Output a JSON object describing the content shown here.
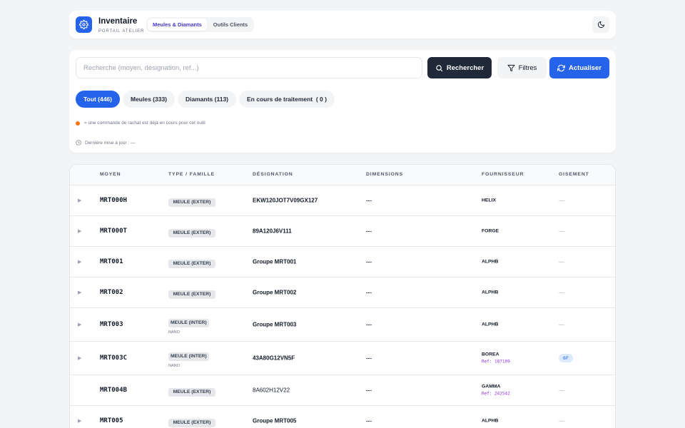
{
  "header": {
    "title": "Inventaire",
    "subtitle": "PORTAIL ATELIER",
    "tabs": [
      {
        "label": "Meules & Diamants",
        "active": true
      },
      {
        "label": "Outils Clients",
        "active": false
      }
    ],
    "icons": {
      "logo": "gear-icon",
      "theme": "moon-icon"
    }
  },
  "controls": {
    "search_placeholder": "Recherche (moyen, désignation, ref...)",
    "search_value": "",
    "search_button": "Rechercher",
    "filter_button": "Filtres",
    "refresh_button": "Actualiser",
    "chips": [
      {
        "label": "Tout (446)",
        "active": true
      },
      {
        "label": "Meules (333)",
        "active": false
      },
      {
        "label": "Diamants (113)",
        "active": false
      },
      {
        "label": "En cours de traitement  ( 0 )",
        "active": false
      }
    ],
    "legend_text": "= une commande de rachat est déjà en cours pour cet outil",
    "last_update": "Dernière mise à jour : —"
  },
  "table": {
    "columns": [
      "MOYEN",
      "TYPE / FAMILLE",
      "DÉSIGNATION",
      "DIMENSIONS",
      "FOURNISSEUR",
      "GISEMENT"
    ],
    "rows": [
      {
        "caret": "▶",
        "moyen": "MRT000H",
        "type": "MEULE (EXTER)",
        "type_style": "block",
        "family": "",
        "designation": "EKW120JOT7V09GX127",
        "designation_bold": true,
        "dimensions": "---",
        "fournisseur": "HELIX",
        "ref": "",
        "gisement": "---",
        "gisement_badge": false
      },
      {
        "caret": "▶",
        "moyen": "MRT000T",
        "type": "MEULE (EXTER)",
        "type_style": "block",
        "family": "",
        "designation": "89A120J6V111",
        "designation_bold": true,
        "dimensions": "---",
        "fournisseur": "FORGE",
        "ref": "",
        "gisement": "---",
        "gisement_badge": false
      },
      {
        "caret": "▶",
        "moyen": "MRT001",
        "type": "MEULE (EXTER)",
        "type_style": "block",
        "family": "",
        "designation": "Groupe MRT001",
        "designation_bold": true,
        "dimensions": "---",
        "fournisseur": "ALPHB",
        "ref": "",
        "gisement": "---",
        "gisement_badge": false
      },
      {
        "caret": "▶",
        "moyen": "MRT002",
        "type": "MEULE (EXTER)",
        "type_style": "block",
        "family": "",
        "designation": "Groupe MRT002",
        "designation_bold": true,
        "dimensions": "---",
        "fournisseur": "ALPHB",
        "ref": "",
        "gisement": "---",
        "gisement_badge": false
      },
      {
        "caret": "▶",
        "moyen": "MRT003",
        "type": "MEULE (INTER)",
        "type_style": "inline",
        "family": "NANO",
        "designation": "Groupe MRT003",
        "designation_bold": true,
        "dimensions": "---",
        "fournisseur": "ALPHB",
        "ref": "",
        "gisement": "---",
        "gisement_badge": false
      },
      {
        "caret": "▶",
        "moyen": "MRT003C",
        "type": "MEULE (INTER)",
        "type_style": "inline",
        "family": "NANO",
        "designation": "43A80G12VN5F",
        "designation_bold": true,
        "dimensions": "---",
        "fournisseur": "BOREA",
        "ref": "Ref: 187109",
        "gisement": "6F",
        "gisement_badge": true
      },
      {
        "caret": "",
        "moyen": "MRT004B",
        "type": "MEULE (EXTER)",
        "type_style": "block",
        "family": "",
        "designation": "8A602H12V22",
        "designation_bold": false,
        "dimensions": "---",
        "fournisseur": "GAMMA",
        "ref": "Ref: 242542",
        "gisement": "---",
        "gisement_badge": false
      },
      {
        "caret": "▶",
        "moyen": "MRT005",
        "type": "MEULE (EXTER)",
        "type_style": "block",
        "family": "",
        "designation": "Groupe MRT005",
        "designation_bold": true,
        "dimensions": "---",
        "fournisseur": "ALPHB",
        "ref": "",
        "gisement": "---",
        "gisement_badge": false
      }
    ]
  },
  "colors": {
    "accent": "#2563eb",
    "dark_button": "#1f2937",
    "ref_text": "#9333ea",
    "legend_dot": "#f97316",
    "badge_bg": "#e5e7eb"
  }
}
